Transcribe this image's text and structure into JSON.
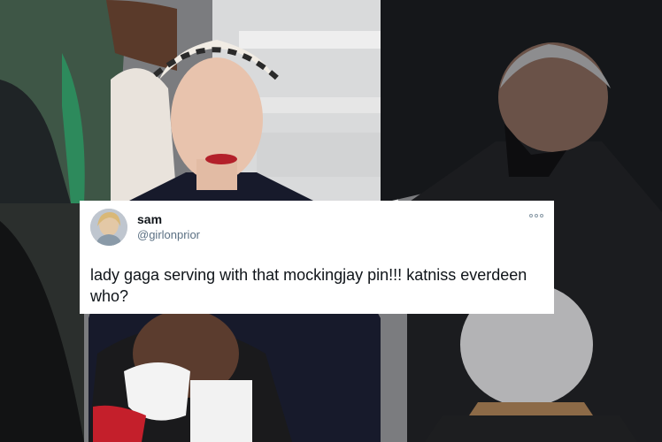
{
  "tweet": {
    "display_name": "sam",
    "handle": "@girlonprior",
    "text": "lady gaga serving with that mockingjay pin!!! katniss everdeen who?"
  },
  "icons": {
    "more": "more-options-icon",
    "avatar": "profile-avatar"
  }
}
